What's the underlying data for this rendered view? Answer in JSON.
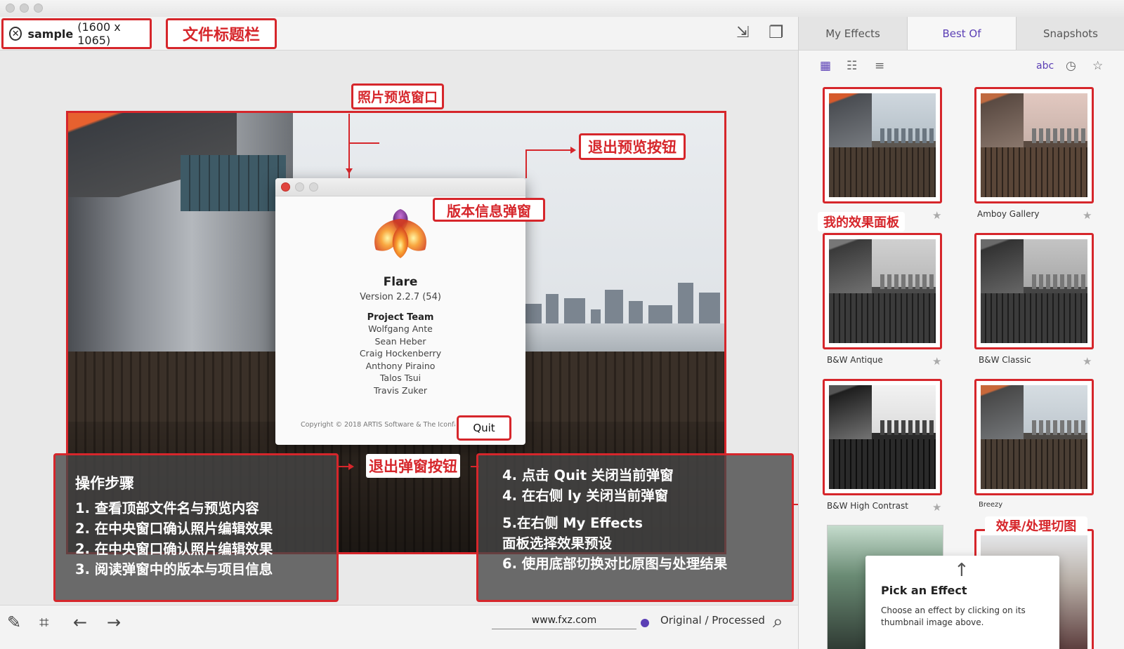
{
  "file_bar": {
    "file_name": "sample",
    "dimensions": "(1600 x 1065)"
  },
  "annotations": {
    "file_title_bar": "文件标题栏",
    "photo_preview": "照片预览窗口",
    "exit_preview_button": "退出预览按钮",
    "version_info_popup": "版本信息弹窗",
    "exit_popup_button": "退出弹窗按钮",
    "my_effects_panel": "我的效果面板",
    "effect_thumbnails": "效果/处理切图"
  },
  "about_dialog": {
    "app_name": "Flare",
    "version": "Version 2.2.7 (54)",
    "team_title": "Project Team",
    "members": [
      "Wolfgang Ante",
      "Sean Heber",
      "Craig Hockenberry",
      "Anthony Piraino",
      "Talos Tsui",
      "Travis Zuker"
    ],
    "copyright": "Copyright © 2018 ARTIS Software & The Iconfactory",
    "quit_label": "Quit"
  },
  "steps_left": {
    "title": "操作步骤",
    "lines": [
      "1. 查看顶部文件名与预览内容",
      "2. 在中央窗口确认照片编辑效果",
      "2. 在中央窗口确认照片编辑效果",
      "3. 阅读弹窗中的版本与项目信息"
    ]
  },
  "steps_right": {
    "lines": [
      "4. 点击 Quit 关闭当前弹窗",
      "4. 在右侧 ly 关闭当前弹窗",
      "5.在右侧 My Effects",
      "面板选择效果预设",
      "6. 使用底部切换对比原图与处理结果"
    ]
  },
  "bottom_bar": {
    "url": "www.fxz.com",
    "toggle_label": "Original / Processed"
  },
  "right_panel": {
    "tabs": [
      "My Effects",
      "Best Of",
      "Snapshots"
    ],
    "active_tab": "Best Of",
    "sort_label": "abc",
    "effects": [
      {
        "name": "",
        "style": "color"
      },
      {
        "name": "Amboy Gallery",
        "style": "warm"
      },
      {
        "name": "B&W Antique",
        "style": "bw"
      },
      {
        "name": "B&W Classic",
        "style": "bw"
      },
      {
        "name": "B&W High Contrast",
        "style": "bwhigh"
      },
      {
        "name": "Breezy",
        "style": "color"
      }
    ],
    "hint": {
      "title": "Pick an Effect",
      "text": "Choose an effect by clicking on its thumbnail image above."
    }
  },
  "colors": {
    "annotation_red": "#d6262b",
    "accent_purple": "#5b3fb5"
  }
}
